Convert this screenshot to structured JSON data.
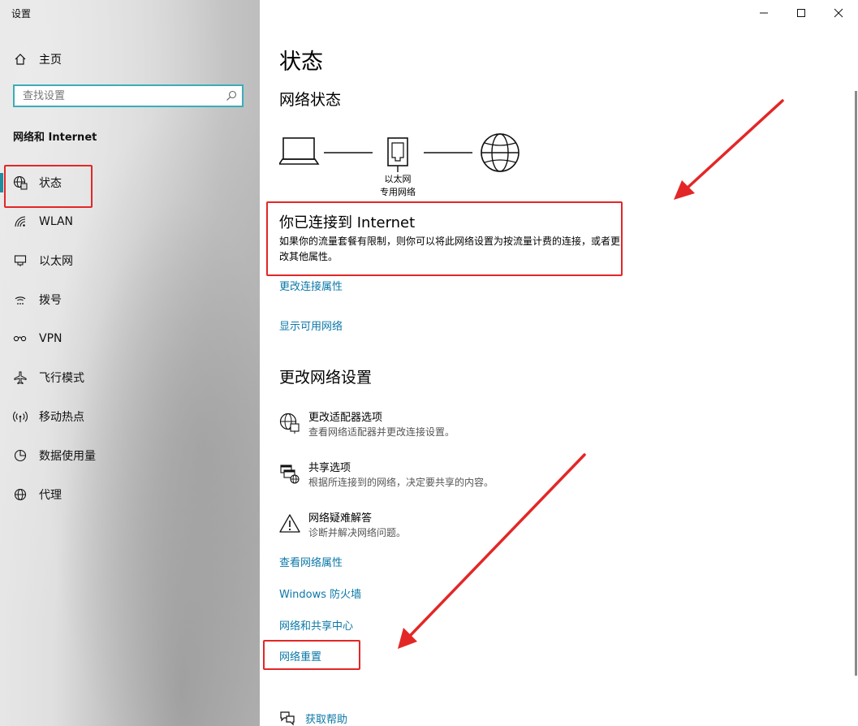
{
  "window": {
    "title": "设置",
    "controls": {
      "minimize": "minimize",
      "maximize": "maximize",
      "close": "close"
    }
  },
  "sidebar": {
    "home_label": "主页",
    "search_placeholder": "查找设置",
    "section_title": "网络和 Internet",
    "items": [
      {
        "label": "状态",
        "icon": "globe-status-icon",
        "active": true
      },
      {
        "label": "WLAN",
        "icon": "wifi-icon"
      },
      {
        "label": "以太网",
        "icon": "ethernet-icon"
      },
      {
        "label": "拨号",
        "icon": "dialup-icon"
      },
      {
        "label": "VPN",
        "icon": "vpn-icon"
      },
      {
        "label": "飞行模式",
        "icon": "airplane-icon"
      },
      {
        "label": "移动热点",
        "icon": "hotspot-icon"
      },
      {
        "label": "数据使用量",
        "icon": "data-usage-icon"
      },
      {
        "label": "代理",
        "icon": "proxy-globe-icon"
      }
    ]
  },
  "main": {
    "page_title": "状态",
    "network_status_title": "网络状态",
    "diagram": {
      "adapter_name": "以太网",
      "network_type": "专用网络"
    },
    "connected_title": "你已连接到 Internet",
    "connected_desc": "如果你的流量套餐有限制，则你可以将此网络设置为按流量计费的连接，或者更改其他属性。",
    "links_top": {
      "change_properties": "更改连接属性",
      "show_networks": "显示可用网络"
    },
    "change_settings_title": "更改网络设置",
    "options": [
      {
        "title": "更改适配器选项",
        "desc": "查看网络适配器并更改连接设置。",
        "icon": "adapter-globe-icon"
      },
      {
        "title": "共享选项",
        "desc": "根据所连接到的网络，决定要共享的内容。",
        "icon": "sharing-icon"
      },
      {
        "title": "网络疑难解答",
        "desc": "诊断并解决网络问题。",
        "icon": "warning-icon"
      }
    ],
    "links_bottom": {
      "view_properties": "查看网络属性",
      "firewall": "Windows 防火墙",
      "sharing_center": "网络和共享中心",
      "network_reset": "网络重置"
    },
    "help_label": "获取帮助"
  },
  "colors": {
    "accent": "#0b78a8",
    "highlight_box": "#e32727",
    "sidebar_active": "#1f8fa0"
  }
}
